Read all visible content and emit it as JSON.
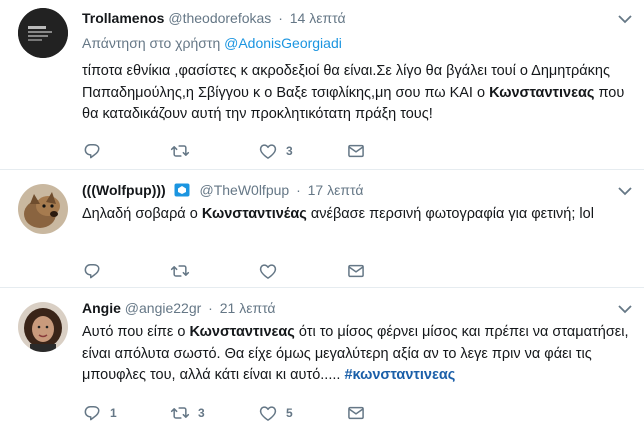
{
  "tweets": [
    {
      "name": "Trollamenos",
      "handle": "@theodorefokas",
      "time": "14 λεπτά",
      "reply_prefix": "Απάντηση στο χρήστη",
      "reply_user": "@AdonisGeorgiadi",
      "text_before": "τίποτα εθνίκια ,φασίστες κ ακροδεξιοί θα είναι.Σε λίγο θα βγάλει τουί ο Δημητράκης Παπαδημούλης,η Σβίγγου κ ο Βαξε τσιφλίκης,μη σου πω ΚΑΙ ο ",
      "text_bold": "Κωνσταντινεας",
      "text_after": " που θα καταδικάζουν αυτή την προκλητικότατη πράξη τους!",
      "replies": "",
      "retweets": "",
      "likes": "3"
    },
    {
      "name": "(((Wolfpup)))",
      "handle": "@TheW0lfpup",
      "time": "17 λεπτά",
      "text_before": "Δηλαδή σοβαρά ο ",
      "text_bold": "Κωνσταντινέας",
      "text_after": " ανέβασε περσινή φωτογραφία για φετινή; lol",
      "replies": "",
      "retweets": "",
      "likes": ""
    },
    {
      "name": "Angie",
      "handle": "@angie22gr",
      "time": "21 λεπτά",
      "text_before": "Αυτό που είπε ο ",
      "text_bold": "Κωνσταντινεας",
      "text_after": " ότι το μίσος φέρνει μίσος και πρέπει να σταματήσει, είναι απόλυτα σωστό. Θα είχε όμως μεγαλύτερη αξία αν το λεγε πριν να φάει τις μπουφλες του, αλλά κάτι είναι κι αυτό..... ",
      "hashtag": "#κωνσταντινεας",
      "replies": "1",
      "retweets": "3",
      "likes": "5"
    }
  ],
  "icons": {
    "reply": "reply-icon",
    "retweet": "retweet-icon",
    "like": "heart-icon",
    "dm": "envelope-icon",
    "caret": "chevron-down-icon",
    "verified": "verified-badge-icon"
  },
  "colors": {
    "link": "#1b95e0",
    "hashtag": "#1b5fa8",
    "muted": "#657786",
    "text": "#14171a",
    "divider": "#e6ecf0"
  }
}
